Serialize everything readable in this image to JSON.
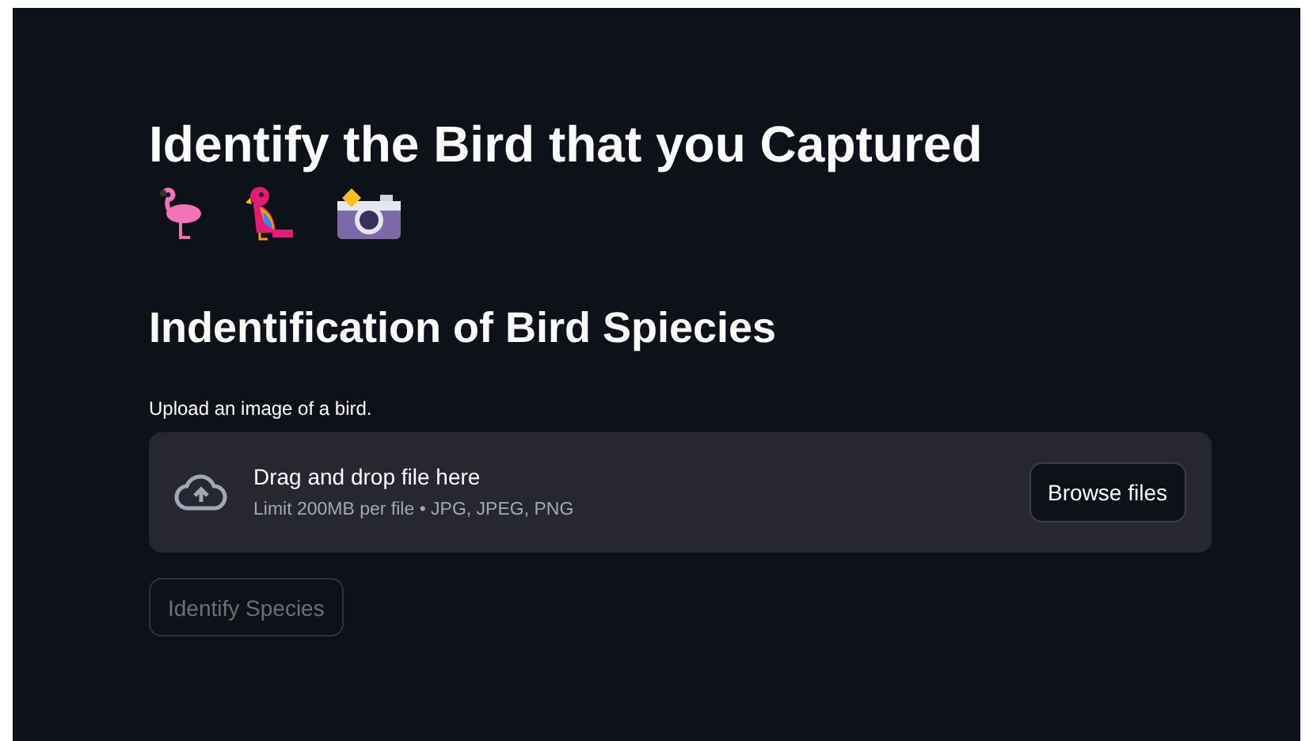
{
  "title": "Identify the Bird that you Captured",
  "subtitle": "Indentification of Bird Spiecies",
  "uploader": {
    "label": "Upload an image of a bird.",
    "drop_text": "Drag and drop file here",
    "limit_text": "Limit 200MB per file • JPG, JPEG, PNG",
    "browse_button": "Browse files"
  },
  "action_button": {
    "label": "Identify Species",
    "disabled": true
  }
}
